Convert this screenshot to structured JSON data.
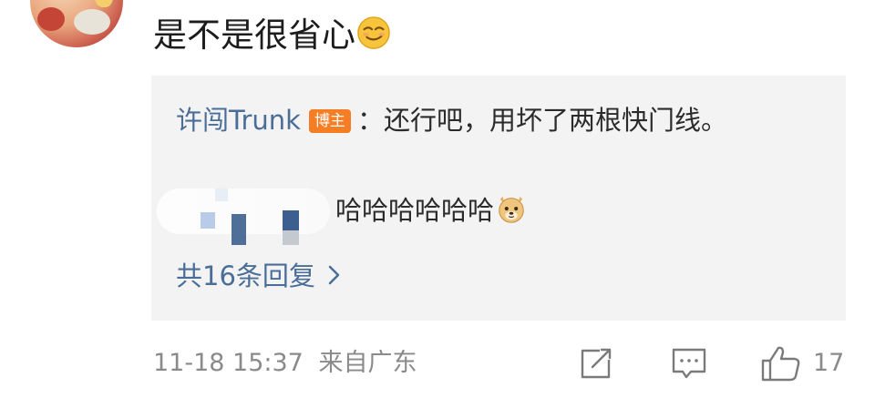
{
  "comment": {
    "text": "是不是很省心",
    "emoji": "smirk-face-emoji"
  },
  "reply_box": {
    "reply1": {
      "username": "许闯Trunk",
      "badge": "博主",
      "text": "：还行吧，用坏了两根快门线。"
    },
    "reply2": {
      "username_obscured": true,
      "text": "哈哈哈哈哈哈",
      "emoji": "doge-emoji"
    },
    "more_replies_label": "共16条回复"
  },
  "footer": {
    "timestamp": "11-18 15:37",
    "location": "来自广东",
    "share_icon": "share-icon",
    "comment_icon": "comment-icon",
    "like_icon": "thumbs-up-icon",
    "like_count": "17"
  },
  "colors": {
    "link_blue": "#4a6e98",
    "badge_orange": "#f57d23",
    "reply_bg": "#f3f3f3",
    "meta_gray": "#8a8a8a"
  }
}
